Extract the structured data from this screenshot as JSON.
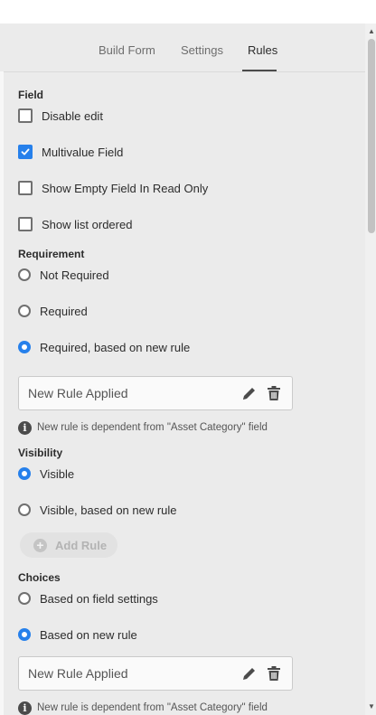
{
  "tabs": [
    {
      "label": "Build Form",
      "active": false
    },
    {
      "label": "Settings",
      "active": false
    },
    {
      "label": "Rules",
      "active": true
    }
  ],
  "field": {
    "title": "Field",
    "options": [
      {
        "label": "Disable edit",
        "checked": false
      },
      {
        "label": "Multivalue Field",
        "checked": true
      },
      {
        "label": "Show Empty Field In Read Only",
        "checked": false
      },
      {
        "label": "Show list ordered",
        "checked": false
      }
    ]
  },
  "requirement": {
    "title": "Requirement",
    "options": [
      {
        "label": "Not Required",
        "selected": false
      },
      {
        "label": "Required",
        "selected": false
      },
      {
        "label": "Required, based on new rule",
        "selected": true
      }
    ],
    "rule_text": "New Rule Applied",
    "note": "New rule is dependent from \"Asset Category\" field"
  },
  "visibility": {
    "title": "Visibility",
    "options": [
      {
        "label": "Visible",
        "selected": true
      },
      {
        "label": "Visible, based on new rule",
        "selected": false
      }
    ],
    "add_rule_label": "Add Rule"
  },
  "choices": {
    "title": "Choices",
    "options": [
      {
        "label": "Based on field settings",
        "selected": false
      },
      {
        "label": "Based on new rule",
        "selected": true
      }
    ],
    "rule_text": "New Rule Applied",
    "note": "New rule is dependent from \"Asset Category\" field"
  },
  "icons": {
    "edit": "pencil-icon",
    "delete": "trash-icon",
    "info": "info-icon",
    "add": "plus-circle-icon",
    "check": "checkmark-icon"
  },
  "colors": {
    "accent": "#2680eb",
    "panel_bg": "#ebebeb"
  }
}
